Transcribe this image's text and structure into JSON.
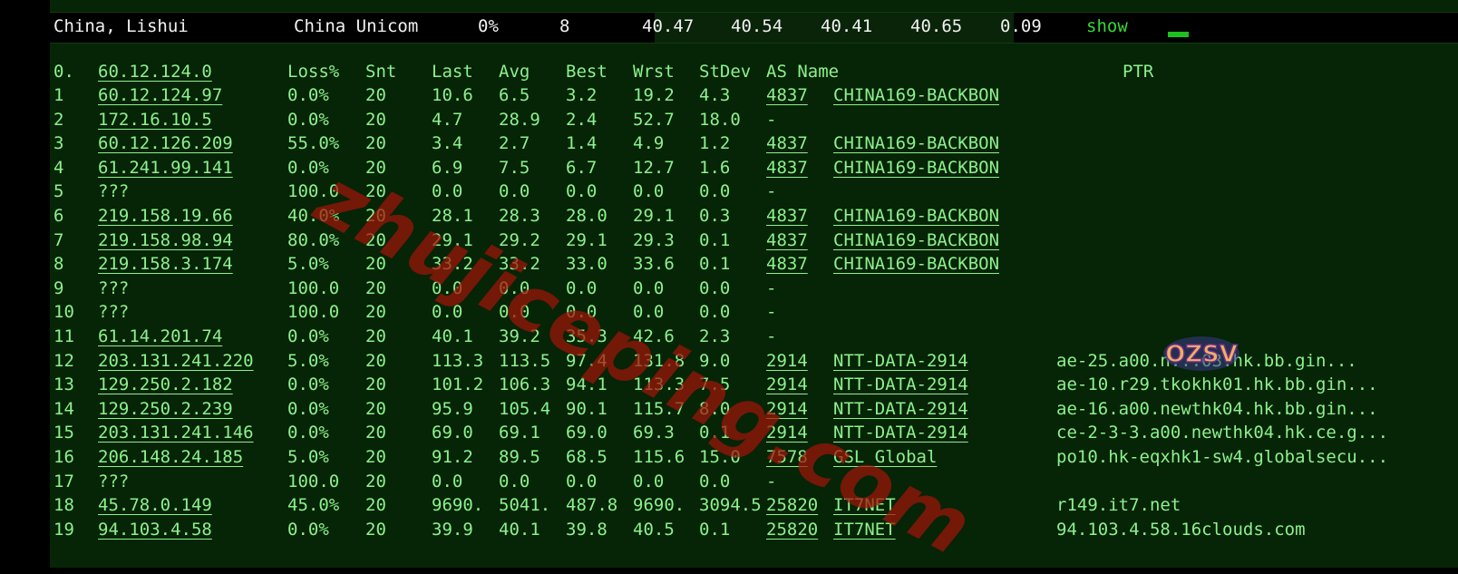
{
  "summary": {
    "location": "China, Lishui",
    "isp": "China Unicom",
    "loss": "0%",
    "hops": "8",
    "v1": "40.47",
    "v2": "40.54",
    "v3": "40.41",
    "v4": "40.65",
    "v5": "0.09",
    "show_label": "show"
  },
  "headers": {
    "dest": "0.",
    "dest_ip": "60.12.124.0",
    "loss": "Loss%",
    "snt": "Snt",
    "last": "Last",
    "avg": "Avg",
    "best": "Best",
    "wrst": "Wrst",
    "stdev": "StDev",
    "asname": "AS Name",
    "ptr": "PTR"
  },
  "hops": [
    {
      "n": "1",
      "ip": "60.12.124.97",
      "loss": "0.0%",
      "snt": "20",
      "last": "10.6",
      "avg": "6.5",
      "best": "3.2",
      "wrst": "19.2",
      "stdev": "4.3",
      "asn": "4837",
      "asname": "CHINA169-BACKBON",
      "ptr": ""
    },
    {
      "n": "2",
      "ip": "172.16.10.5",
      "loss": "0.0%",
      "snt": "20",
      "last": "4.7",
      "avg": "28.9",
      "best": "2.4",
      "wrst": "52.7",
      "stdev": "18.0",
      "asn": "-",
      "asname": "",
      "ptr": ""
    },
    {
      "n": "3",
      "ip": "60.12.126.209",
      "loss": "55.0%",
      "snt": "20",
      "last": "3.4",
      "avg": "2.7",
      "best": "1.4",
      "wrst": "4.9",
      "stdev": "1.2",
      "asn": "4837",
      "asname": "CHINA169-BACKBON",
      "ptr": ""
    },
    {
      "n": "4",
      "ip": "61.241.99.141",
      "loss": "0.0%",
      "snt": "20",
      "last": "6.9",
      "avg": "7.5",
      "best": "6.7",
      "wrst": "12.7",
      "stdev": "1.6",
      "asn": "4837",
      "asname": "CHINA169-BACKBON",
      "ptr": ""
    },
    {
      "n": "5",
      "ip": "???",
      "loss": "100.0",
      "snt": "20",
      "last": "0.0",
      "avg": "0.0",
      "best": "0.0",
      "wrst": "0.0",
      "stdev": "0.0",
      "asn": "-",
      "asname": "",
      "ptr": ""
    },
    {
      "n": "6",
      "ip": "219.158.19.66",
      "loss": "40.0%",
      "snt": "20",
      "last": "28.1",
      "avg": "28.3",
      "best": "28.0",
      "wrst": "29.1",
      "stdev": "0.3",
      "asn": "4837",
      "asname": "CHINA169-BACKBON",
      "ptr": ""
    },
    {
      "n": "7",
      "ip": "219.158.98.94",
      "loss": "80.0%",
      "snt": "20",
      "last": "29.1",
      "avg": "29.2",
      "best": "29.1",
      "wrst": "29.3",
      "stdev": "0.1",
      "asn": "4837",
      "asname": "CHINA169-BACKBON",
      "ptr": ""
    },
    {
      "n": "8",
      "ip": "219.158.3.174",
      "loss": "5.0%",
      "snt": "20",
      "last": "33.2",
      "avg": "33.2",
      "best": "33.0",
      "wrst": "33.6",
      "stdev": "0.1",
      "asn": "4837",
      "asname": "CHINA169-BACKBON",
      "ptr": ""
    },
    {
      "n": "9",
      "ip": "???",
      "loss": "100.0",
      "snt": "20",
      "last": "0.0",
      "avg": "0.0",
      "best": "0.0",
      "wrst": "0.0",
      "stdev": "0.0",
      "asn": "-",
      "asname": "",
      "ptr": ""
    },
    {
      "n": "10",
      "ip": "???",
      "loss": "100.0",
      "snt": "20",
      "last": "0.0",
      "avg": "0.0",
      "best": "0.0",
      "wrst": "0.0",
      "stdev": "0.0",
      "asn": "-",
      "asname": "",
      "ptr": ""
    },
    {
      "n": "11",
      "ip": "61.14.201.74",
      "loss": "0.0%",
      "snt": "20",
      "last": "40.1",
      "avg": "39.2",
      "best": "35.3",
      "wrst": "42.6",
      "stdev": "2.3",
      "asn": "-",
      "asname": "",
      "ptr": ""
    },
    {
      "n": "12",
      "ip": "203.131.241.220",
      "loss": "5.0%",
      "snt": "20",
      "last": "113.3",
      "avg": "113.5",
      "best": "97.4",
      "wrst": "131.8",
      "stdev": "9.0",
      "asn": "2914",
      "asname": "NTT-DATA-2914",
      "ptr": "ae-25.a00.n...03.hk.bb.gin..."
    },
    {
      "n": "13",
      "ip": "129.250.2.182",
      "loss": "0.0%",
      "snt": "20",
      "last": "101.2",
      "avg": "106.3",
      "best": "94.1",
      "wrst": "113.3",
      "stdev": "7.5",
      "asn": "2914",
      "asname": "NTT-DATA-2914",
      "ptr": "ae-10.r29.tkokhk01.hk.bb.gin..."
    },
    {
      "n": "14",
      "ip": "129.250.2.239",
      "loss": "0.0%",
      "snt": "20",
      "last": "95.9",
      "avg": "105.4",
      "best": "90.1",
      "wrst": "115.7",
      "stdev": "8.0",
      "asn": "2914",
      "asname": "NTT-DATA-2914",
      "ptr": "ae-16.a00.newthk04.hk.bb.gin..."
    },
    {
      "n": "15",
      "ip": "203.131.241.146",
      "loss": "0.0%",
      "snt": "20",
      "last": "69.0",
      "avg": "69.1",
      "best": "69.0",
      "wrst": "69.3",
      "stdev": "0.1",
      "asn": "2914",
      "asname": "NTT-DATA-2914",
      "ptr": "ce-2-3-3.a00.newthk04.hk.ce.g..."
    },
    {
      "n": "16",
      "ip": "206.148.24.185",
      "loss": "5.0%",
      "snt": "20",
      "last": "91.2",
      "avg": "89.5",
      "best": "68.5",
      "wrst": "115.6",
      "stdev": "15.0",
      "asn": "7578",
      "asname": "GSL Global",
      "ptr": "po10.hk-eqxhk1-sw4.globalsecu..."
    },
    {
      "n": "17",
      "ip": "???",
      "loss": "100.0",
      "snt": "20",
      "last": "0.0",
      "avg": "0.0",
      "best": "0.0",
      "wrst": "0.0",
      "stdev": "0.0",
      "asn": "-",
      "asname": "",
      "ptr": ""
    },
    {
      "n": "18",
      "ip": "45.78.0.149",
      "loss": "45.0%",
      "snt": "20",
      "last": "9690.",
      "avg": "5041.",
      "best": "487.8",
      "wrst": "9690.",
      "stdev": "3094.5",
      "asn": "25820",
      "asname": "IT7NET",
      "ptr": "r149.it7.net"
    },
    {
      "n": "19",
      "ip": "94.103.4.58",
      "loss": "0.0%",
      "snt": "20",
      "last": "39.9",
      "avg": "40.1",
      "best": "39.8",
      "wrst": "40.5",
      "stdev": "0.1",
      "asn": "25820",
      "asname": "IT7NET",
      "ptr": "94.103.4.58.16clouds.com"
    }
  ],
  "watermark": "zhujiceping.com",
  "logo": "OZSV",
  "colors": {
    "text": "#8cf28c",
    "panel": "#062406",
    "accent": "#1fbf1f",
    "watermark": "#a0140a"
  }
}
